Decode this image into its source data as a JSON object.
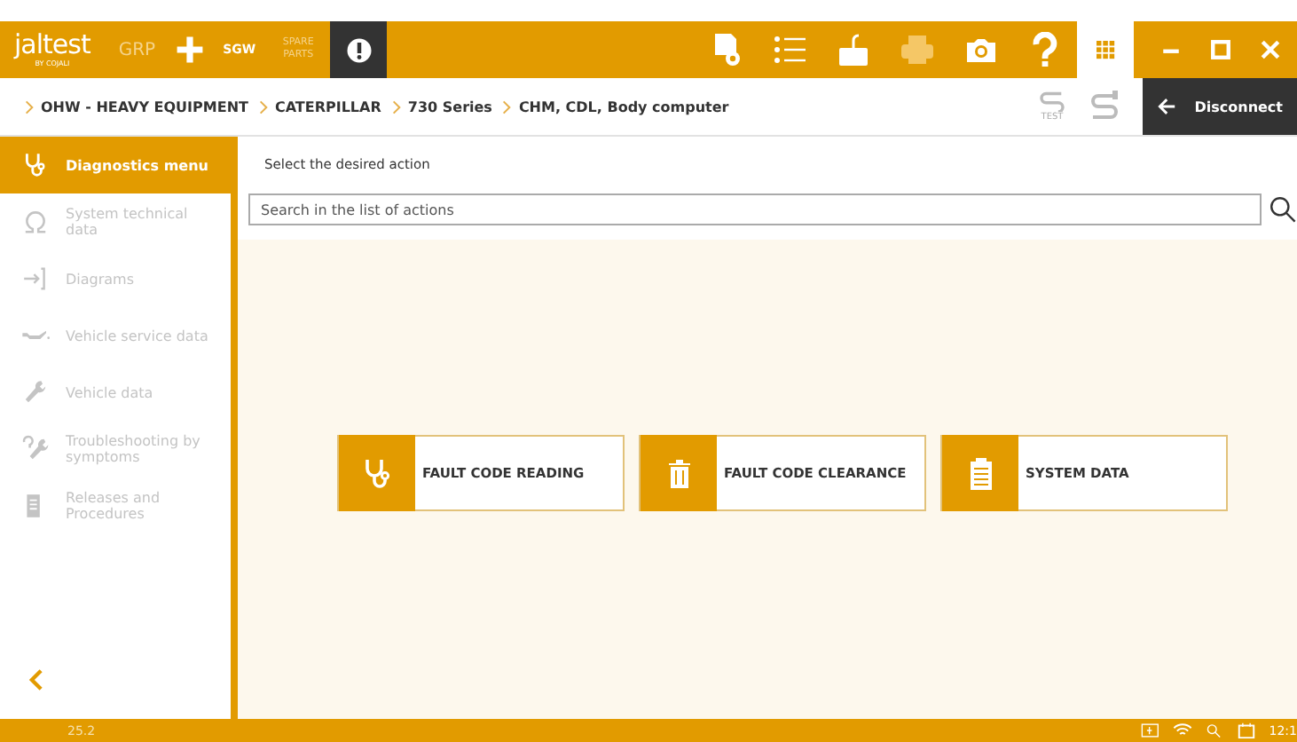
{
  "toolbar": {
    "logo": "jaltest",
    "logo_sub": "BY COJALI",
    "modules": [
      {
        "label": "GRP",
        "kind": "text"
      },
      {
        "label": "SGW",
        "kind": "badge"
      },
      {
        "label": "SPARE PARTS",
        "kind": "stack"
      }
    ]
  },
  "breadcrumb": [
    "OHW - HEAVY EQUIPMENT",
    "CATERPILLAR",
    "730 Series",
    "CHM, CDL, Body computer"
  ],
  "test_label": "TEST",
  "disconnect": "Disconnect",
  "sidebar": {
    "items": [
      {
        "label": "Diagnostics menu",
        "kind": "stethoscope",
        "selected": true,
        "disabled": false
      },
      {
        "label": "System technical data",
        "kind": "omega",
        "selected": false,
        "disabled": true
      },
      {
        "label": "Diagrams",
        "kind": "diagram",
        "selected": false,
        "disabled": true
      },
      {
        "label": "Vehicle service data",
        "kind": "oilcan",
        "selected": false,
        "disabled": true
      },
      {
        "label": "Vehicle data",
        "kind": "wrench",
        "selected": false,
        "disabled": true
      },
      {
        "label": "Troubleshooting by symptoms",
        "kind": "question",
        "selected": false,
        "disabled": true
      },
      {
        "label": "Releases and Procedures",
        "kind": "document",
        "selected": false,
        "disabled": true
      }
    ]
  },
  "main": {
    "instruction": "Select the desired action",
    "search": {
      "placeholder": "Search in the list of actions"
    },
    "actions": [
      {
        "label": "FAULT CODE READING",
        "kind": "stethoscope"
      },
      {
        "label": "FAULT CODE CLEARANCE",
        "kind": "trash"
      },
      {
        "label": "SYSTEM DATA",
        "kind": "clipboard"
      }
    ]
  },
  "status_bar": {
    "version": "25.2",
    "time": "12:1"
  }
}
